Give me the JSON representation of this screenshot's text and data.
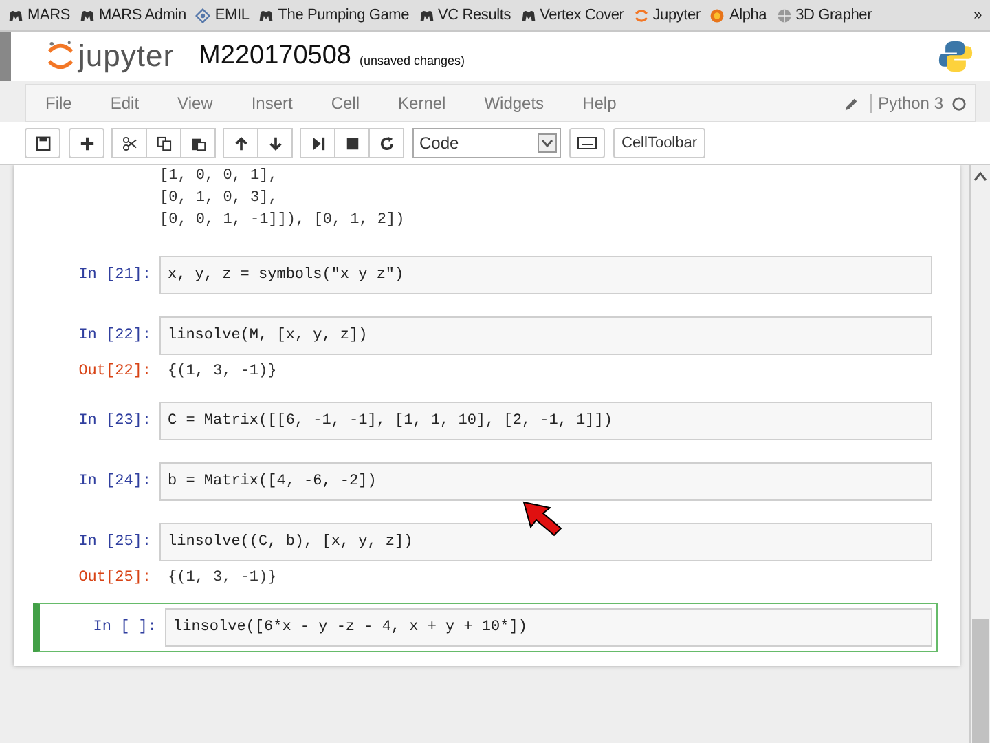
{
  "bookmarks": [
    {
      "label": "MARS",
      "kind": "mars"
    },
    {
      "label": "MARS Admin",
      "kind": "mars"
    },
    {
      "label": "EMIL",
      "kind": "emil"
    },
    {
      "label": "The Pumping Game",
      "kind": "mars"
    },
    {
      "label": "VC Results",
      "kind": "mars"
    },
    {
      "label": "Vertex Cover",
      "kind": "mars"
    },
    {
      "label": "Jupyter",
      "kind": "jupyter"
    },
    {
      "label": "Alpha",
      "kind": "alpha"
    },
    {
      "label": "3D Grapher",
      "kind": "globe"
    }
  ],
  "bookmarks_more": "»",
  "header": {
    "logo": "jupyter",
    "title": "M220170508",
    "status": "(unsaved changes)"
  },
  "menu": [
    "File",
    "Edit",
    "View",
    "Insert",
    "Cell",
    "Kernel",
    "Widgets",
    "Help"
  ],
  "kernel": "Python 3",
  "toolbar": {
    "cell_type": "Code",
    "celltoolbar": "CellToolbar"
  },
  "output_continued": [
    "[1, 0, 0,  1],",
    "[0, 1, 0,  3],",
    "[0, 0, 1, -1]]), [0, 1, 2])"
  ],
  "cells": [
    {
      "prompt": "In [21]:",
      "code": "x, y, z = symbols(\"x y z\")",
      "selected": false
    },
    {
      "prompt": "In [22]:",
      "code": "linsolve(M, [x, y, z])",
      "selected": false,
      "output_prompt": "Out[22]:",
      "output": "{(1, 3, -1)}"
    },
    {
      "prompt": "In [23]:",
      "code": "C = Matrix([[6, -1, -1], [1, 1, 10], [2, -1, 1]])",
      "selected": false
    },
    {
      "prompt": "In [24]:",
      "code": "b = Matrix([4, -6, -2])",
      "selected": false
    },
    {
      "prompt": "In [25]:",
      "code": "linsolve((C, b), [x, y, z])",
      "selected": false,
      "output_prompt": "Out[25]:",
      "output": "{(1, 3, -1)}"
    },
    {
      "prompt": "In [ ]:",
      "code": "linsolve([6*x - y -z - 4, x + y + 10*])",
      "selected": true
    }
  ]
}
